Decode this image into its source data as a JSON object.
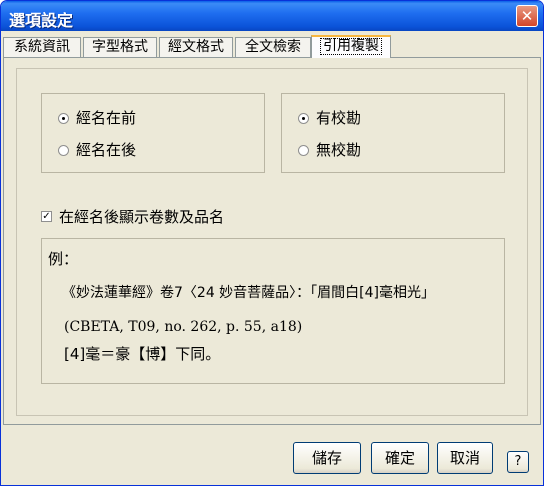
{
  "window": {
    "title": "選項設定",
    "close_glyph": "✕"
  },
  "tabs": [
    {
      "label": "系統資訊"
    },
    {
      "label": "字型格式"
    },
    {
      "label": "經文格式"
    },
    {
      "label": "全文檢索"
    },
    {
      "label": "引用複製",
      "active": true
    }
  ],
  "sutra_position": {
    "options": [
      {
        "label": "經名在前",
        "checked": true
      },
      {
        "label": "經名在後",
        "checked": false
      }
    ]
  },
  "collation": {
    "options": [
      {
        "label": "有校勘",
        "checked": true
      },
      {
        "label": "無校勘",
        "checked": false
      }
    ]
  },
  "show_juan_checkbox": {
    "label": "在經名後顯示卷數及品名",
    "checked": true,
    "mark": "✓"
  },
  "example": {
    "heading": "例：",
    "line1": "《妙法蓮華經》卷7〈24 妙音菩薩品〉：「眉間白[4]毫相光」",
    "line2": "(CBETA, T09, no. 262, p. 55, a18)",
    "line3": "[4]毫＝豪【博】下同。"
  },
  "buttons": {
    "save": "儲存",
    "ok": "確定",
    "cancel": "取消",
    "help": "?"
  }
}
